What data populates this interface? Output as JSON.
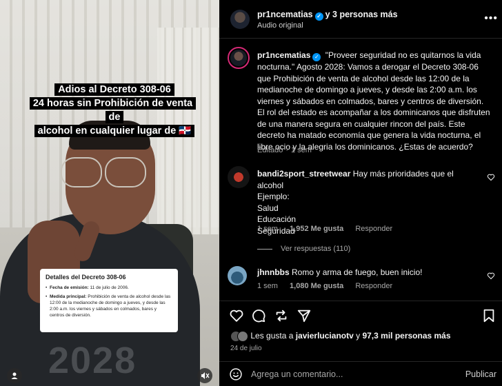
{
  "video": {
    "caption": [
      "Adios al Decreto 308-06",
      "24 horas sin Prohibición de venta de",
      "alcohol en cualquier lugar de 🇩🇴"
    ],
    "shirt_text": "2028",
    "card": {
      "title": "Detalles del Decreto 308-06",
      "items": [
        {
          "label": "Fecha de emisión:",
          "text": " 11 de julio de 2006."
        },
        {
          "label": "Medida principal:",
          "text": " Prohibición de venta de alcohol desde las 12:00 de la medianoche de domingo a jueves, y desde las 2:00 a.m. los viernes y sábados en colmados, bares y centros de diversión."
        }
      ]
    },
    "icons": [
      "user-icon",
      "mute-icon"
    ]
  },
  "header": {
    "username": "pr1ncematias",
    "others": "y 3 personas más",
    "subtitle": "Audio original",
    "more_label": "•••"
  },
  "caption_post": {
    "username": "pr1ncematias",
    "text": "\"Proveer seguridad no es quitarnos la vida nocturna.\" Agosto 2028: Vamos a derogar el Decreto 308-06 que Prohibición de venta de alcohol desde las 12:00 de la medianoche de domingo a jueves, y desde las 2:00 a.m. los viernes y sábados en colmados, bares y centros de diversión. El rol del estado es acompañar a los dominicanos que disfruten de una manera segura en cualquier rincon del país. Este decreto ha matado economía que genera la vida nocturna, el libre ocio y la alegria los dominicanos. ¿Estas de acuerdo?",
    "edited": "Editado",
    "time": "1 sem"
  },
  "comments": [
    {
      "username": "bandi2sport_streetwear",
      "text": "Hay más prioridades que el alcohol",
      "lines": [
        "Ejemplo:",
        "Salud",
        "Educación",
        "Seguridad"
      ],
      "time": "1 sem",
      "likes": "1,952 Me gusta",
      "reply": "Responder",
      "view_replies": "Ver respuestas (110)"
    },
    {
      "username": "jhnnbbs",
      "text": "Romo y arma de fuego, buen inicio!",
      "time": "1 sem",
      "likes": "1,080 Me gusta",
      "reply": "Responder"
    }
  ],
  "likes": {
    "prefix": "Les gusta a ",
    "user": "javierlucianotv",
    "middle": " y ",
    "rest": "97,3 mil personas más"
  },
  "date": "24 de julio",
  "composer": {
    "placeholder": "Agrega un comentario...",
    "post_label": "Publicar"
  },
  "colors": {
    "verified": "#0095f6",
    "muted_text": "#a8a8a8",
    "divider": "#262626"
  }
}
